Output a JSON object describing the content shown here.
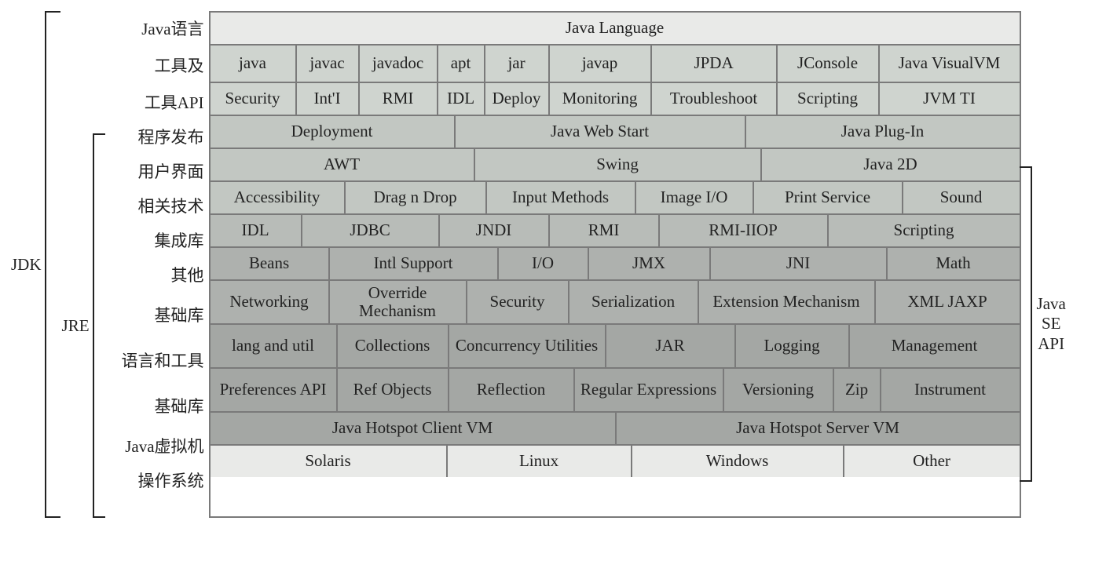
{
  "brackets": {
    "jdk": "JDK",
    "jre": "JRE",
    "javase": "Java\nSE\nAPI"
  },
  "rowLabels": {
    "lang": "Java语言",
    "tools": "工具及",
    "toolsapi": "工具API",
    "deploy": "程序发布",
    "ui": "用户界面",
    "reltech": "相关技术",
    "integ": "集成库",
    "other": "其他",
    "base": "基础库",
    "langtool": "语言和工具",
    "base2": "基础库",
    "jvm": "Java虚拟机",
    "os": "操作系统"
  },
  "rows": {
    "lang": [
      "Java Language"
    ],
    "tools": [
      "java",
      "javac",
      "javadoc",
      "apt",
      "jar",
      "javap",
      "JPDA",
      "JConsole",
      "Java VisualVM"
    ],
    "toolsapi": [
      "Security",
      "Int'I",
      "RMI",
      "IDL",
      "Deploy",
      "Monitoring",
      "Troubleshoot",
      "Scripting",
      "JVM TI"
    ],
    "deploy": [
      "Deployment",
      "Java Web Start",
      "Java Plug-In"
    ],
    "ui": [
      "AWT",
      "Swing",
      "Java 2D"
    ],
    "reltech": [
      "Accessibility",
      "Drag n Drop",
      "Input Methods",
      "Image I/O",
      "Print Service",
      "Sound"
    ],
    "integ": [
      "IDL",
      "JDBC",
      "JNDI",
      "RMI",
      "RMI-IIOP",
      "Scripting"
    ],
    "other": [
      "Beans",
      "Intl Support",
      "I/O",
      "JMX",
      "JNI",
      "Math"
    ],
    "base": [
      "Networking",
      "Override Mechanism",
      "Security",
      "Serialization",
      "Extension Mechanism",
      "XML JAXP"
    ],
    "langtool": [
      "lang and util",
      "Collections",
      "Concurrency Utilities",
      "JAR",
      "Logging",
      "Management"
    ],
    "base2": [
      "Preferences API",
      "Ref Objects",
      "Reflection",
      "Regular Expressions",
      "Versioning",
      "Zip",
      "Instrument"
    ],
    "jvm": [
      "Java Hotspot Client VM",
      "Java Hotspot Server VM"
    ],
    "os": [
      "Solaris",
      "Linux",
      "Windows",
      "Other"
    ]
  }
}
